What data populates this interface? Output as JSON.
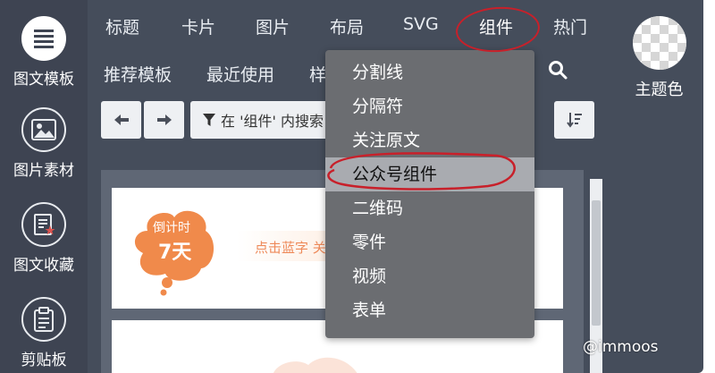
{
  "colors": {
    "frame": "#454d5b",
    "sidebar": "#3e4452",
    "dropdown_bg": "#6b6d71",
    "dropdown_highlight": "#a9abb0",
    "annotation_red": "#c8202a",
    "badge_orange": "#f08a4b",
    "promo_text": "#ee8a5a"
  },
  "sidebar": {
    "items": [
      {
        "label": "图文模板",
        "icon": "list-icon"
      },
      {
        "label": "图片素材",
        "icon": "image-icon"
      },
      {
        "label": "图文收藏",
        "icon": "doc-star-icon"
      },
      {
        "label": "剪贴板",
        "icon": "clipboard-icon"
      }
    ]
  },
  "nav": {
    "tabs": [
      "标题",
      "卡片",
      "图片",
      "布局",
      "SVG",
      "组件",
      "热门"
    ],
    "active": "组件"
  },
  "subnav": {
    "tabs": [
      "推荐模板",
      "最近使用",
      "样"
    ]
  },
  "toolbar": {
    "back_icon": "arrow-left-icon",
    "forward_icon": "arrow-right-icon",
    "filter_text": "在 '组件' 内搜索",
    "filter_icon": "filter-icon",
    "sort_icon": "sort-desc-icon"
  },
  "search_icon": "search-icon",
  "theme": {
    "label": "主题色"
  },
  "dropdown": {
    "items": [
      "分割线",
      "分隔符",
      "关注原文",
      "公众号组件",
      "二维码",
      "零件",
      "视频",
      "表单"
    ],
    "highlighted": "公众号组件"
  },
  "card": {
    "badge_line1": "倒计时",
    "badge_line2": "7天",
    "promo_text": "点击蓝字 关"
  },
  "watermark": "@immoos"
}
